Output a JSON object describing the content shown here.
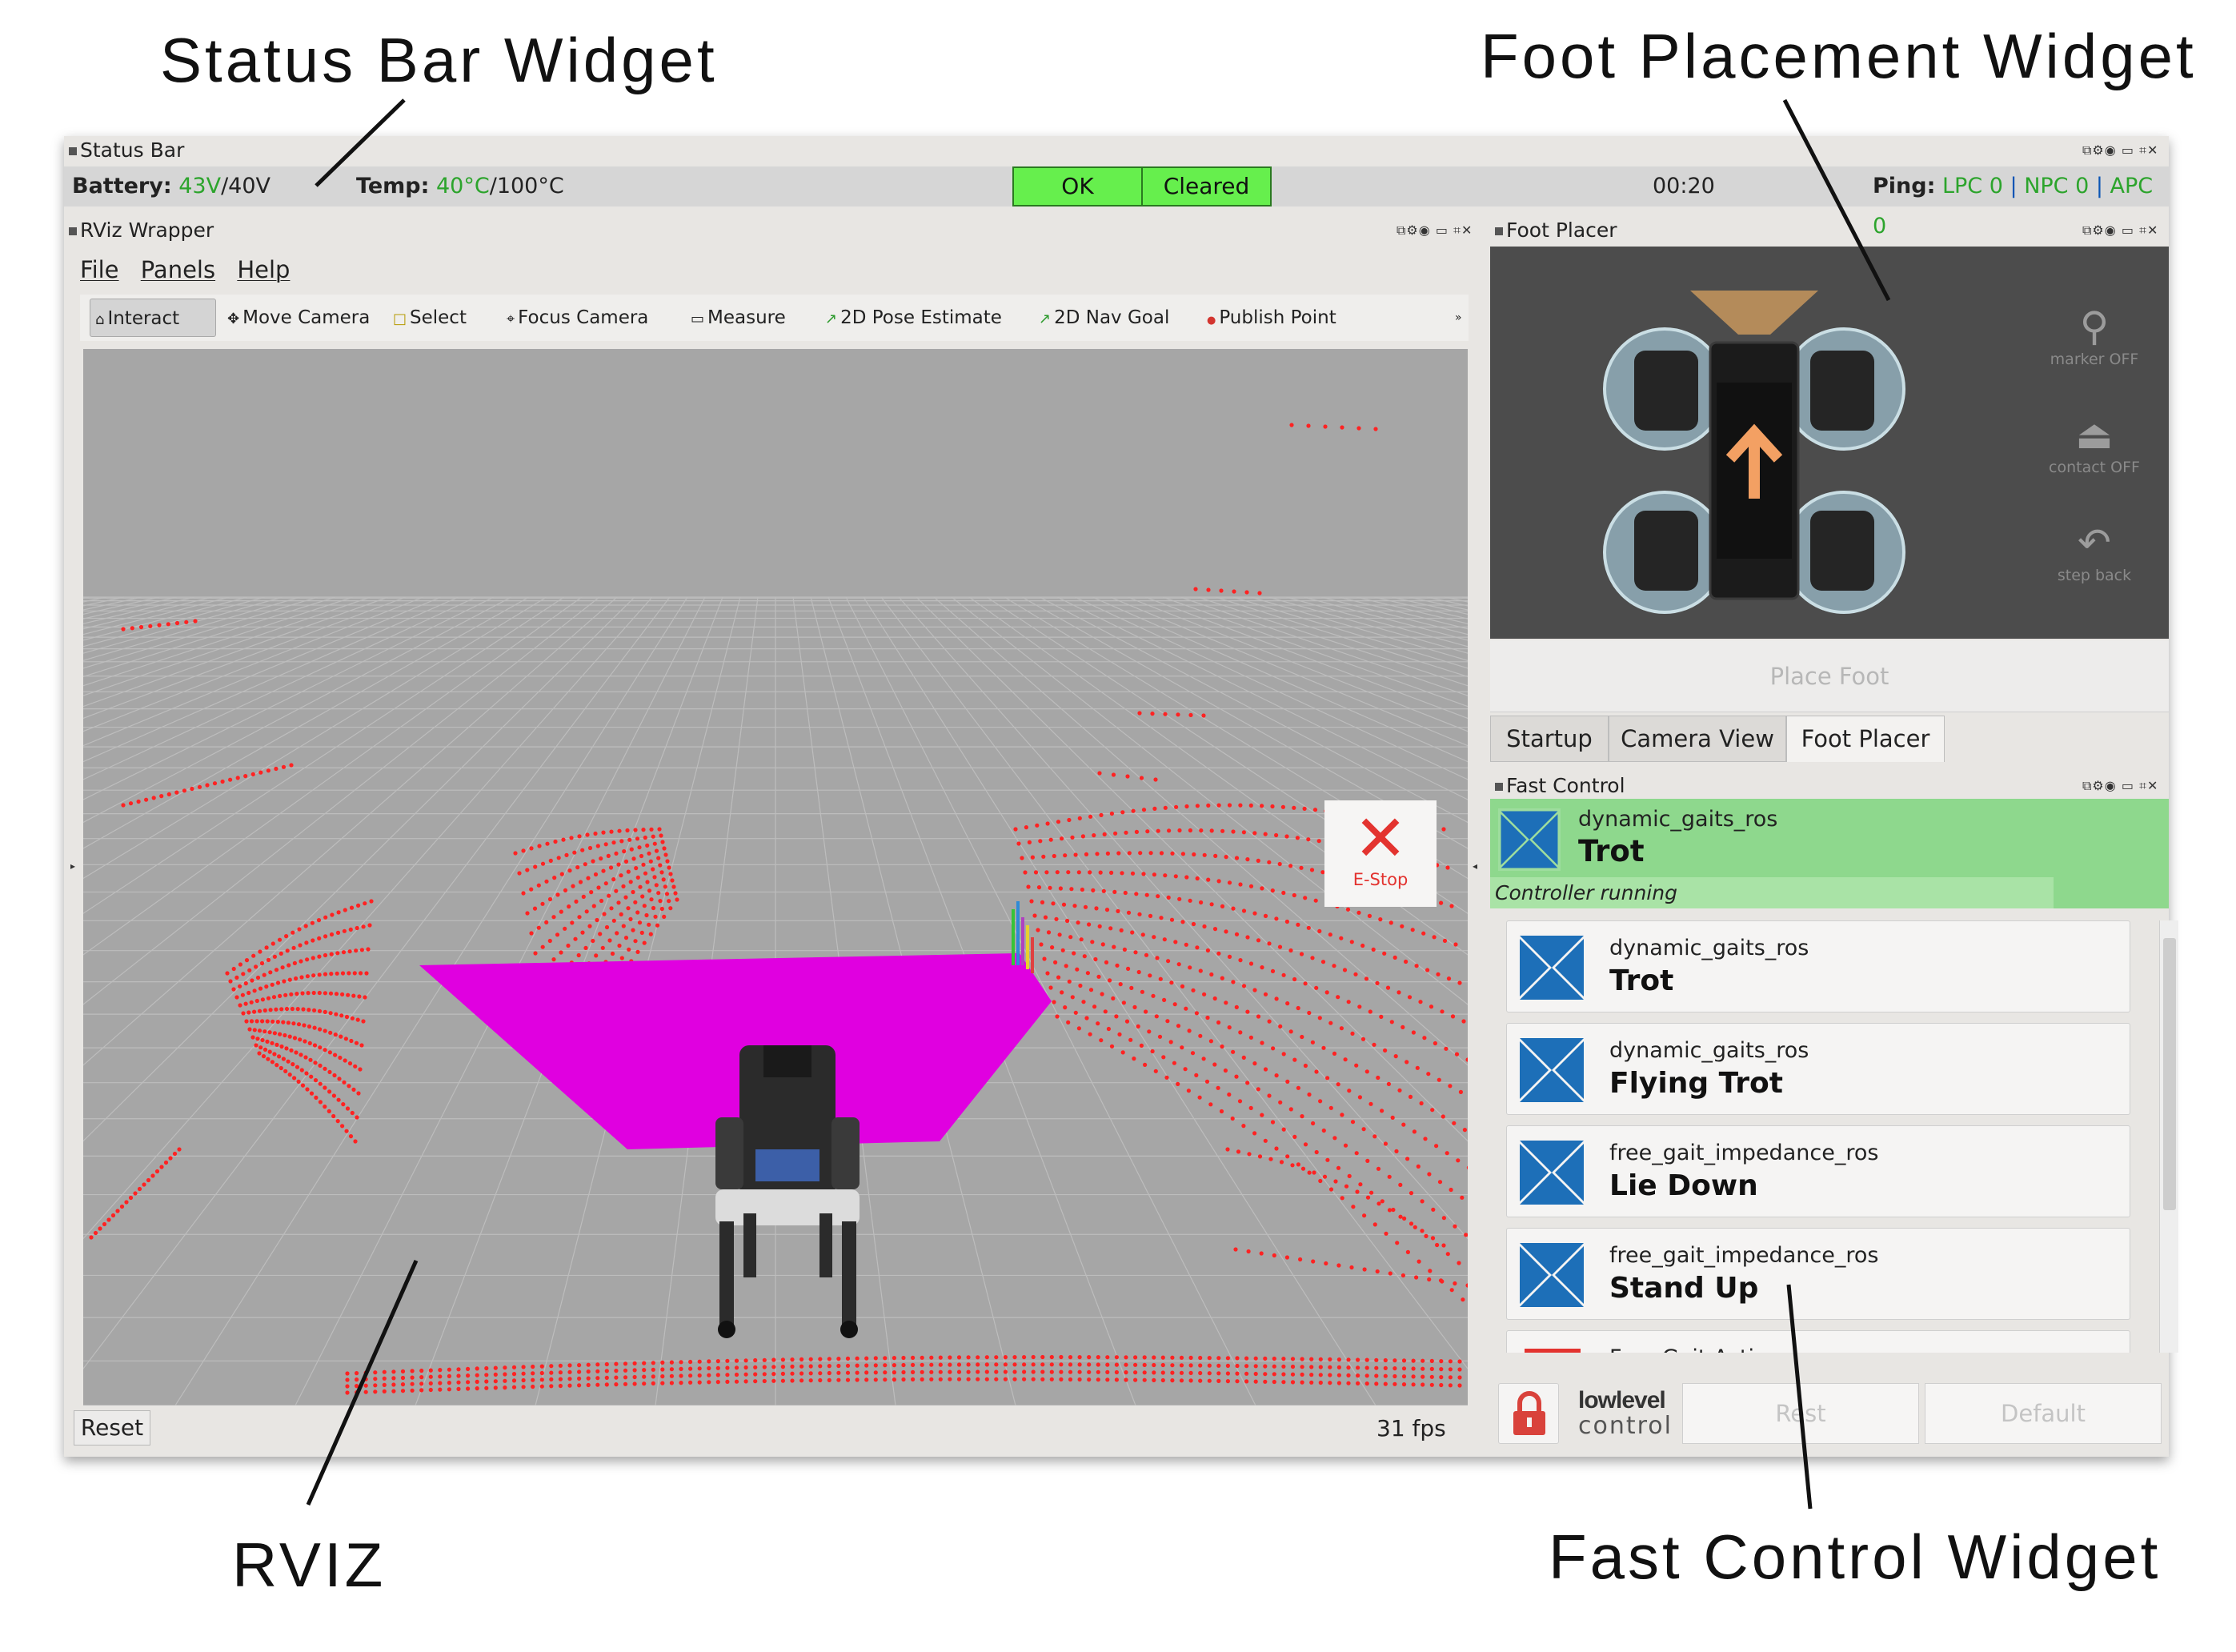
{
  "callouts": {
    "status_bar": "Status Bar Widget",
    "foot_placement": "Foot Placement Widget",
    "rviz": "RVIZ",
    "fast_control": "Fast Control Widget"
  },
  "status_bar": {
    "dock_title": "Status Bar",
    "battery_label": "Battery:",
    "battery_value": "43V",
    "battery_max": "/40V",
    "temp_label": "Temp:",
    "temp_value": "40°C",
    "temp_max": "/100°C",
    "ok_button": "OK",
    "cleared_button": "Cleared",
    "timer": "00:20",
    "ping_label": "Ping:",
    "ping_lpc": "LPC 0",
    "ping_npc": "NPC 0",
    "ping_apc": "APC 0",
    "separator": " | "
  },
  "rviz": {
    "dock_title": "RViz Wrapper",
    "menu": [
      "File",
      "Panels",
      "Help"
    ],
    "tools": [
      {
        "label": "Interact",
        "icon": "interact-icon",
        "glyph": "⌂"
      },
      {
        "label": "Move Camera",
        "icon": "move-camera-icon",
        "glyph": "✥"
      },
      {
        "label": "Select",
        "icon": "select-icon",
        "glyph": "□"
      },
      {
        "label": "Focus Camera",
        "icon": "focus-camera-icon",
        "glyph": "⌖"
      },
      {
        "label": "Measure",
        "icon": "measure-icon",
        "glyph": "▭"
      },
      {
        "label": "2D Pose Estimate",
        "icon": "pose-estimate-icon",
        "glyph": "↗"
      },
      {
        "label": "2D Nav Goal",
        "icon": "nav-goal-icon",
        "glyph": "↗"
      },
      {
        "label": "Publish Point",
        "icon": "publish-point-icon",
        "glyph": "●"
      }
    ],
    "overflow": "»",
    "reset_button": "Reset",
    "fps": "31 fps",
    "colors": {
      "background": "#a6a6a6",
      "grid": "#bdbdbd",
      "elevation_map": "#e000e0",
      "point_cloud": "#ff2222"
    }
  },
  "foot_placer": {
    "dock_title": "Foot Placer",
    "marker_label": "marker OFF",
    "contact_label": "contact OFF",
    "step_back_label": "step back",
    "place_foot_button": "Place Foot",
    "tabs": [
      "Startup",
      "Camera View",
      "Foot Placer"
    ],
    "active_tab": "Foot Placer"
  },
  "fast_control": {
    "dock_title": "Fast Control",
    "active": {
      "package": "dynamic_gaits_ros",
      "name": "Trot",
      "status": "Controller running"
    },
    "estop_label": "E-Stop",
    "controllers": [
      {
        "package": "dynamic_gaits_ros",
        "name": "Trot"
      },
      {
        "package": "dynamic_gaits_ros",
        "name": "Flying Trot"
      },
      {
        "package": "free_gait_impedance_ros",
        "name": "Lie Down"
      },
      {
        "package": "free_gait_impedance_ros",
        "name": "Stand Up"
      }
    ],
    "free_gait_action": "Free Gait Action",
    "lowlevel_line1": "lowlevel",
    "lowlevel_line2": "control",
    "rest_button": "Rest",
    "default_button": "Default",
    "colors": {
      "active_bg": "#8ed88d",
      "estop": "#e3332f",
      "logo_blue": "#1d6fb8"
    }
  }
}
